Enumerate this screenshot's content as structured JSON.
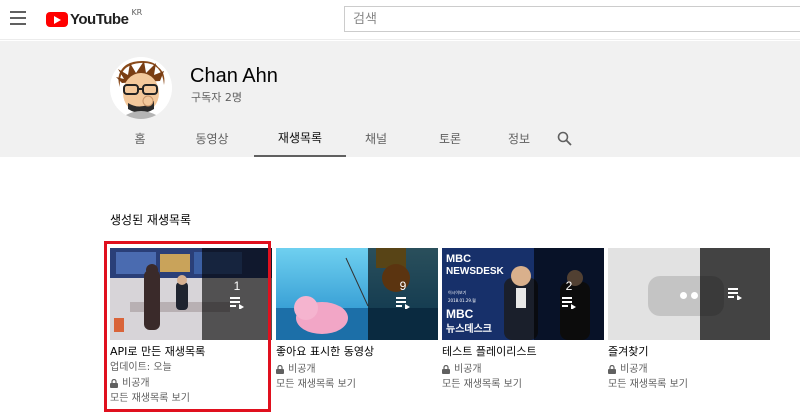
{
  "header": {
    "logo_text": "YouTube",
    "logo_region": "KR",
    "search_placeholder": "검색"
  },
  "channel": {
    "name": "Chan Ahn",
    "subscribers": "구독자 2명"
  },
  "tabs": [
    {
      "label": "홈"
    },
    {
      "label": "동영상"
    },
    {
      "label": "재생목록",
      "active": true
    },
    {
      "label": "채널"
    },
    {
      "label": "토론"
    },
    {
      "label": "정보"
    }
  ],
  "section": {
    "title": "생성된 재생목록"
  },
  "playlists": [
    {
      "title": "API로 만든 재생목록",
      "count": "1",
      "updated": "업데이트: 오늘",
      "privacy": "비공개",
      "view_all": "모든 재생목록 보기"
    },
    {
      "title": "좋아요 표시한 동영상",
      "count": "9",
      "privacy": "비공개",
      "view_all": "모든 재생목록 보기"
    },
    {
      "title": "테스트 플레이리스트",
      "count": "2",
      "privacy": "비공개",
      "view_all": "모든 재생목록 보기"
    },
    {
      "title": "즐겨찾기",
      "privacy": "비공개",
      "view_all": "모든 재생목록 보기"
    }
  ],
  "thumbnail_text": {
    "news_logo": "MBC",
    "news_label": "NEWSDESK",
    "news_caption": "뉴스데스크",
    "news_date": "2018.01.29.월",
    "news_tag": "이시이보기"
  },
  "colors": {
    "brand_red": "#ff0000",
    "highlight_border": "#e0101e",
    "header_bg": "#f1f1f1"
  }
}
